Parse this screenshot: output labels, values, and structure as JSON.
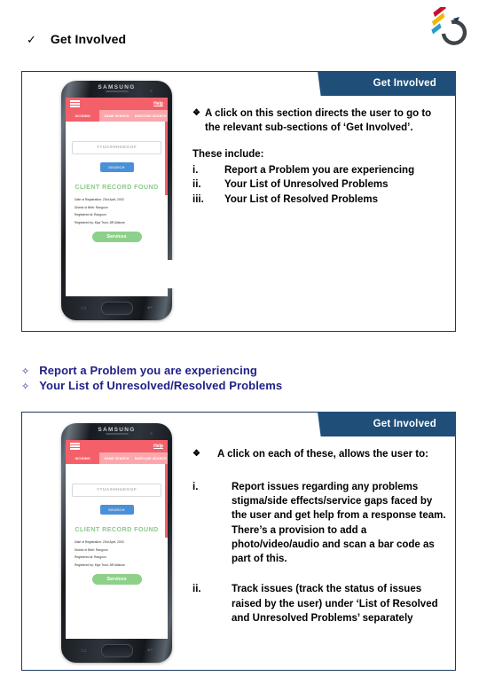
{
  "logo": {
    "name": "circle-arrow-logo",
    "ring_color": "#3F4448",
    "bar_colors": [
      "#C8102E",
      "#F2B705",
      "#2E9CCA",
      "#1F3864"
    ]
  },
  "top_heading": {
    "check_icon": "✓",
    "title": "Get Involved"
  },
  "box1": {
    "banner_label": "Get Involved",
    "bullet_mark": "❖",
    "bullet_text": "A click on this section directs the user to go to the relevant sub-sections of ‘Get Involved’.",
    "intro": "These include:",
    "items": [
      {
        "num": "i.",
        "text": "Report a Problem you are experiencing"
      },
      {
        "num": "ii.",
        "text": "Your List of Unresolved Problems"
      },
      {
        "num": "iii.",
        "text": "Your List of Resolved Problems"
      }
    ]
  },
  "mid_list": {
    "star_icon": "✧",
    "items": [
      "Report a Problem you are experiencing",
      "Your List of Unresolved/Resolved Problems"
    ]
  },
  "box2": {
    "banner_label": "Get Involved",
    "bullet_mark": "❖",
    "bullet_text": "A click on each of these, allows the user to:",
    "items": [
      {
        "num": "i.",
        "text": "Report issues regarding any problems stigma/side effects/service gaps faced by the user and get help from a response team. There’s a provision to add a photo/video/audio and scan a bar code as part of this."
      },
      {
        "num": "ii.",
        "text": "Track issues (track the status of issues raised by the user) under ‘List of Resolved and Unresolved Problems’ separately"
      }
    ]
  },
  "phone": {
    "brand": "SAMSUNG",
    "appbar": {
      "menu_icon": "hamburger-icon",
      "help_label": "Help"
    },
    "tabs": [
      {
        "label": "UIC/SIMO",
        "active": true
      },
      {
        "label": "NAME SEARCH",
        "active": false
      },
      {
        "label": "BARCODE SEARCH",
        "active": false
      }
    ],
    "search_input_placeholder": "YTUASHHUKGGF",
    "search_button_label": "SEARCH",
    "result_heading": "CLIENT RECORD FOUND",
    "records": [
      "Date of Registration: 23rd April, 2003",
      "District of Birth: Rangoon",
      "Registered at: Rangoon",
      "Registered by: Mya Trust, BR Alliance"
    ],
    "services_button_label": "Services",
    "nav_square_icon": "▭",
    "nav_back_icon": "↩"
  },
  "colors": {
    "box_border": "#1F3864",
    "banner_bg": "#1F4E79",
    "mid_text": "#202089",
    "app_red": "#F4606A",
    "search_blue": "#4A90D9",
    "services_green": "#8DD08A",
    "found_green": "#8CC98A"
  }
}
